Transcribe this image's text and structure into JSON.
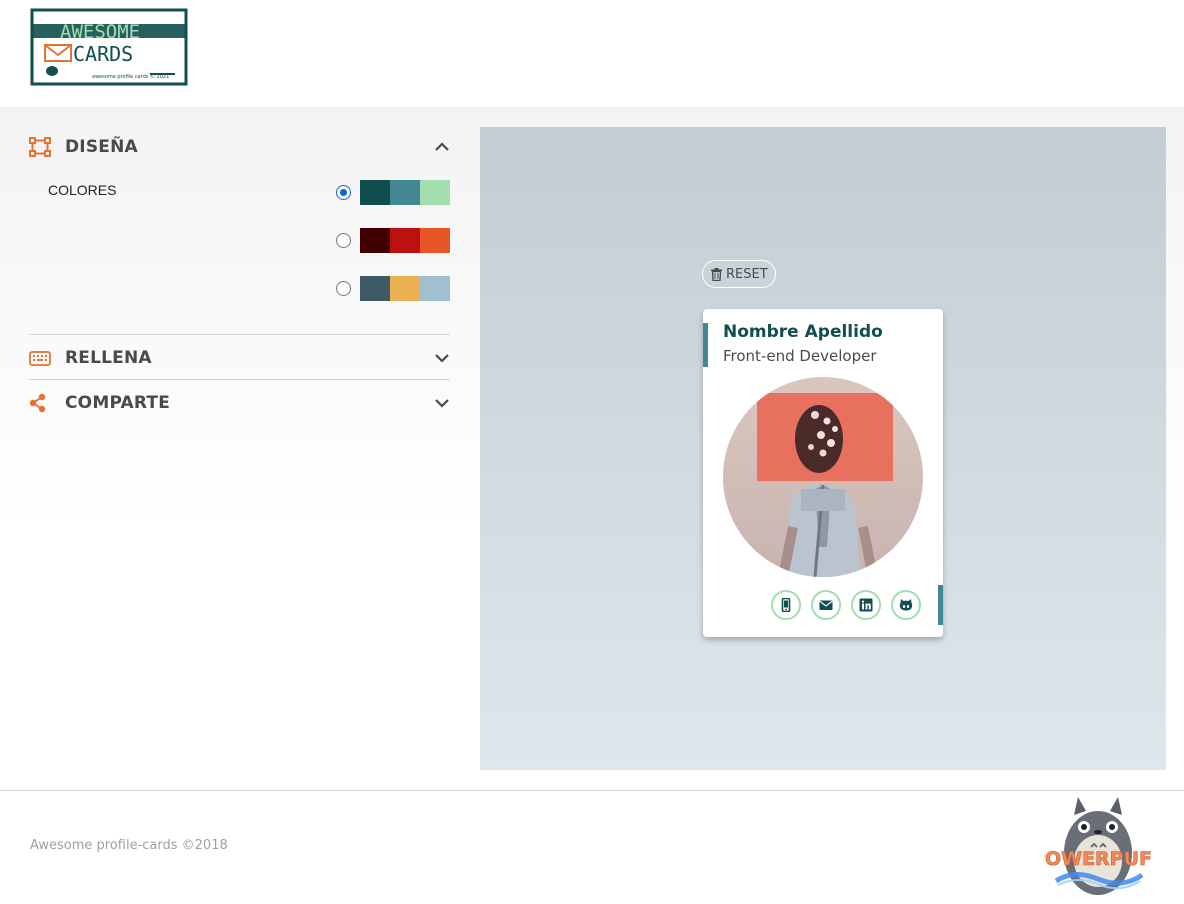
{
  "header": {
    "logo_text_line1": "AWESOME",
    "logo_text_line2": "CARDS",
    "logo_small_text": "awesome profile cards © 2021"
  },
  "panel": {
    "design": {
      "title": "DISEÑA",
      "icon": "object-group-icon",
      "expanded": true,
      "colors_label": "COLORES",
      "palettes": [
        {
          "selected": true,
          "colors": [
            "#114e4e",
            "#438792",
            "#a2deaf"
          ]
        },
        {
          "selected": false,
          "colors": [
            "#420101",
            "#bd1010",
            "#e95626"
          ]
        },
        {
          "selected": false,
          "colors": [
            "#3e5b65",
            "#eab052",
            "#a0c0cf"
          ]
        }
      ]
    },
    "fill": {
      "title": "RELLENA",
      "icon": "keyboard-icon",
      "expanded": false
    },
    "share": {
      "title": "COMPARTE",
      "icon": "share-icon",
      "expanded": false
    }
  },
  "preview": {
    "reset_label": "RESET",
    "card": {
      "name": "Nombre Apellido",
      "job": "Front-end Developer",
      "social_icons": [
        "mobile-icon",
        "envelope-icon",
        "linkedin-icon",
        "github-icon"
      ]
    }
  },
  "footer": {
    "copyright": "Awesome profile-cards ©2018",
    "brand_text": "POWERPUFF"
  },
  "colors": {
    "accent_orange": "#e17334",
    "dark_teal": "#114e4e",
    "mid_teal": "#438792",
    "light_green": "#a2deaf"
  }
}
